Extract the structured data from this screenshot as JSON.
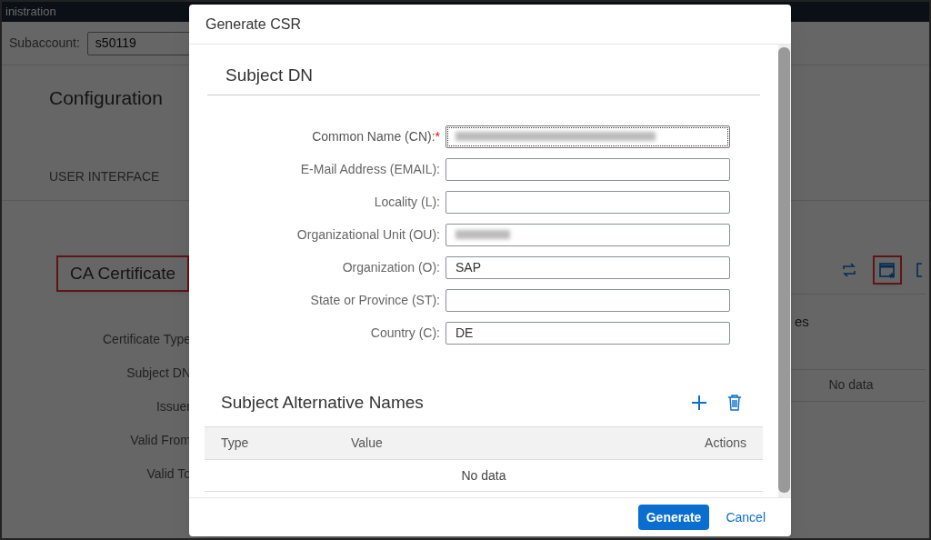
{
  "background": {
    "app_title": "inistration",
    "subaccount": {
      "label": "Subaccount:",
      "value": "s50119"
    },
    "heading": "Configuration",
    "tab": "USER INTERFACE",
    "ca_certificate": {
      "title": "CA Certificate",
      "highlighted": true,
      "fields": [
        "Certificate Type",
        "Subject DN",
        "Issuer",
        "Valid From",
        "Valid To"
      ]
    },
    "toolbar": [
      {
        "kind": "refresh",
        "highlighted": false
      },
      {
        "kind": "calendar",
        "highlighted": true
      },
      {
        "kind": "partial",
        "highlighted": false
      }
    ],
    "side_text": "es",
    "empty_text": "No data"
  },
  "dialog": {
    "title": "Generate CSR",
    "subject_dn": {
      "title": "Subject DN",
      "required_mark": "*",
      "fields": [
        {
          "label": "Common Name (CN):",
          "required": true,
          "redacted": true,
          "focused": true
        },
        {
          "label": "E-Mail Address (EMAIL):",
          "required": false,
          "redacted": false,
          "focused": false
        },
        {
          "label": "Locality (L):",
          "required": false,
          "redacted": false,
          "focused": false
        },
        {
          "label": "Organizational Unit (OU):",
          "required": false,
          "redacted": true,
          "focused": false
        },
        {
          "label": "Organization (O):",
          "required": false,
          "redacted": false,
          "focused": false,
          "value": "SAP"
        },
        {
          "label": "State or Province (ST):",
          "required": false,
          "redacted": false,
          "focused": false
        },
        {
          "label": "Country (C):",
          "required": false,
          "redacted": false,
          "focused": false,
          "value": "DE"
        }
      ]
    },
    "alternative_names": {
      "title": "Subject Alternative Names",
      "columns": [
        "Type",
        "Value",
        "Actions"
      ],
      "empty_text": "No data"
    },
    "buttons": [
      {
        "label": "Generate",
        "kind": "primary"
      },
      {
        "label": "Cancel",
        "kind": "link"
      }
    ]
  }
}
